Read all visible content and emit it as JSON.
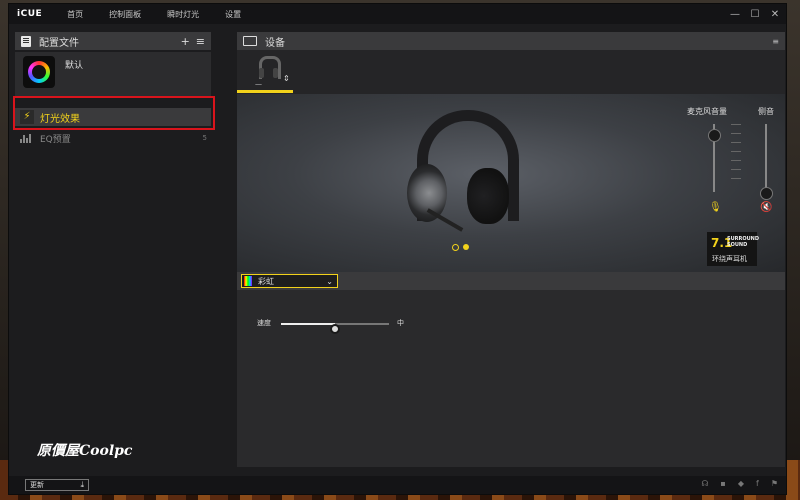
{
  "app": {
    "logo": "iCUE"
  },
  "nav": [
    {
      "label": "首页"
    },
    {
      "label": "控制面板"
    },
    {
      "label": "瞬时灯光"
    },
    {
      "label": "设置"
    }
  ],
  "window_controls": {
    "minimize": "—",
    "maximize": "☐",
    "close": "✕"
  },
  "left": {
    "title": "配置文件",
    "add": "+",
    "menu": "≡",
    "profile": {
      "name": "默认"
    },
    "lighting": {
      "label": "灯光效果",
      "icon": "lightning-icon"
    },
    "eq": {
      "label": "EQ预置",
      "count": "5"
    }
  },
  "main": {
    "title": "设备",
    "device_tab": {
      "usb": "⇕",
      "dash": "—"
    },
    "mic_volume_label": "麦克风音量",
    "sidetone_label": "侧音",
    "surround": {
      "number": "7.1",
      "line1": "SURROUND",
      "line2": "SOUND",
      "sub": "环绕声耳机"
    },
    "carousel": {
      "active_index": 1
    },
    "effect": {
      "selected": "彩虹"
    },
    "speed": {
      "label": "速度",
      "value": "中",
      "level": 0.5
    },
    "mic_volume_level": 0.85,
    "sidetone_level": 0.0
  },
  "bottom": {
    "update": "更新",
    "icons": [
      "headset-icon",
      "chat-icon",
      "twitter-icon",
      "facebook-icon",
      "corsair-icon"
    ]
  },
  "watermark": "原價屋Coolpc",
  "colors": {
    "accent": "#f2d21b",
    "highlight": "#d9141c"
  }
}
